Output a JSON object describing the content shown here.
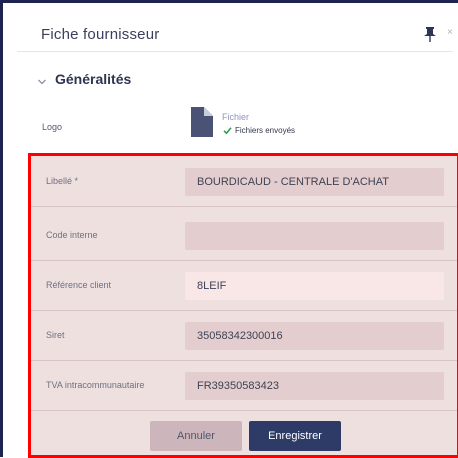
{
  "header": {
    "title": "Fiche fournisseur",
    "close_label": "×"
  },
  "section": {
    "title": "Généralités"
  },
  "logo": {
    "label": "Logo",
    "file_link": "Fichier",
    "file_status": "Fichiers envoyés"
  },
  "fields": [
    {
      "label": "Libellé *",
      "value": "BOURDICAUD - CENTRALE D'ACHAT"
    },
    {
      "label": "Code interne",
      "value": ""
    },
    {
      "label": "Référence client",
      "value": "8LEIF"
    },
    {
      "label": "Siret",
      "value": "35058342300016"
    },
    {
      "label": "TVA intracommunautaire",
      "value": "FR39350583423"
    }
  ],
  "actions": {
    "cancel_label": "Annuler",
    "save_label": "Enregistrer"
  },
  "colors": {
    "highlight_border": "#ff0000",
    "primary": "#2d3b66",
    "status_ok": "#2e9c4c"
  }
}
